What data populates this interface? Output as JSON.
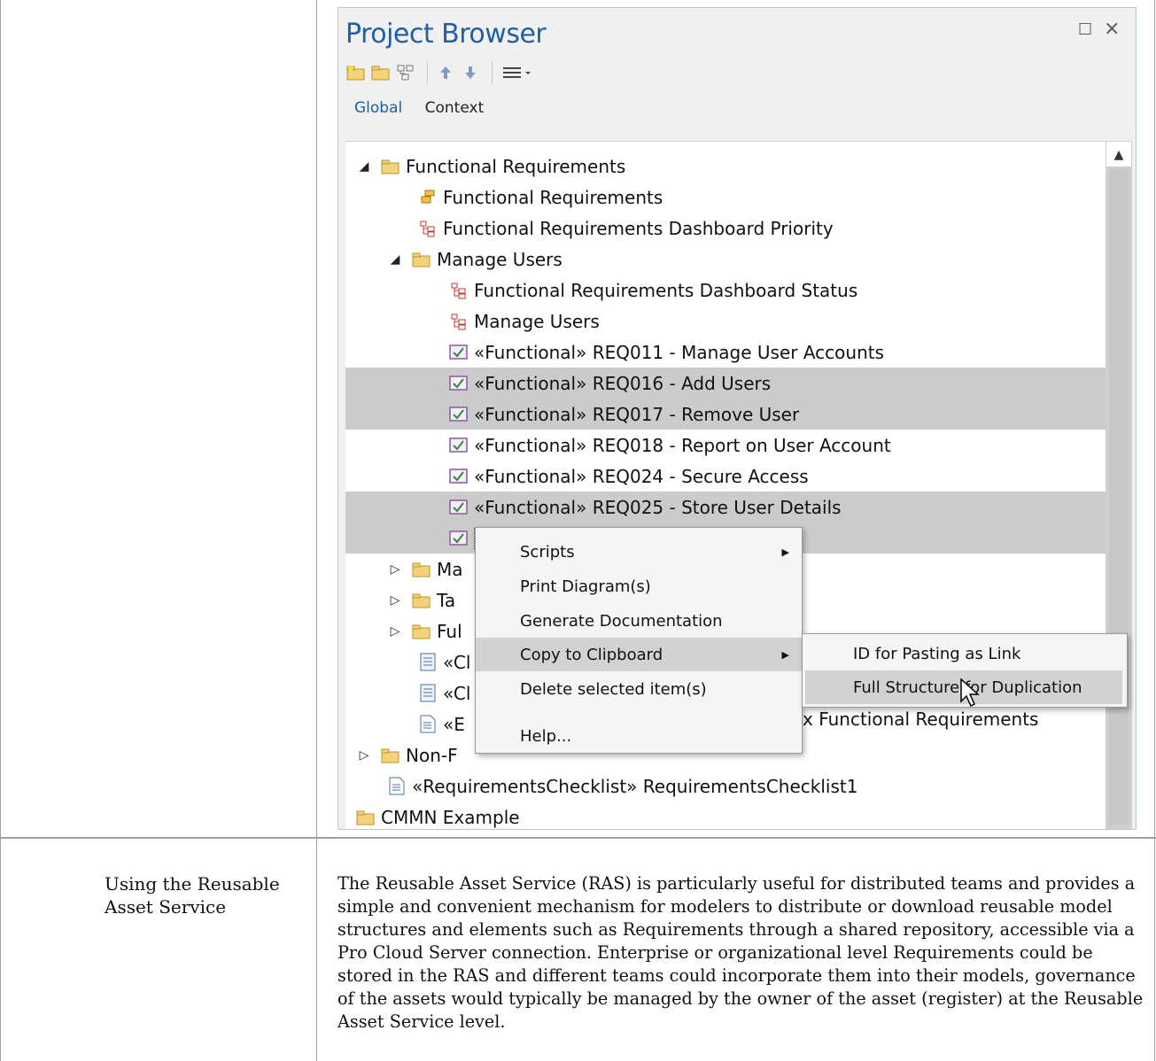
{
  "window": {
    "title": "Project Browser",
    "maximize_glyph": "☐",
    "close_glyph": "×"
  },
  "toolbar": {
    "icons": [
      "new-package-icon",
      "new-folder-icon",
      "new-diagram-icon",
      "move-up-icon",
      "move-down-icon",
      "menu-icon"
    ]
  },
  "tabs": [
    {
      "label": "Global",
      "active": true
    },
    {
      "label": "Context",
      "active": false
    }
  ],
  "tree": {
    "rows": [
      {
        "label": "Functional Requirements",
        "icon": "package-folder-icon",
        "expand": "▲",
        "selected": false
      },
      {
        "label": "Functional Requirements",
        "icon": "package-diagram-icon",
        "expand": "",
        "selected": false
      },
      {
        "label": "Functional Requirements Dashboard Priority",
        "icon": "dashboard-diagram-icon",
        "expand": "",
        "selected": false
      },
      {
        "label": "Manage Users",
        "icon": "package-folder-icon",
        "expand": "▲",
        "selected": false
      },
      {
        "label": "Functional Requirements Dashboard Status",
        "icon": "dashboard-diagram-icon",
        "expand": "",
        "selected": false
      },
      {
        "label": "Manage Users",
        "icon": "dashboard-diagram-icon",
        "expand": "",
        "selected": false
      },
      {
        "label": "«Functional» REQ011 - Manage User Accounts",
        "icon": "requirement-icon",
        "expand": "",
        "selected": false
      },
      {
        "label": "«Functional» REQ016 - Add Users",
        "icon": "requirement-icon",
        "expand": "",
        "selected": true
      },
      {
        "label": "«Functional» REQ017 - Remove User",
        "icon": "requirement-icon",
        "expand": "",
        "selected": true
      },
      {
        "label": "«Functional» REQ018 - Report on User Account",
        "icon": "requirement-icon",
        "expand": "",
        "selected": false
      },
      {
        "label": "«Functional» REQ024 - Secure Access",
        "icon": "requirement-icon",
        "expand": "",
        "selected": false
      },
      {
        "label": "«Functional» REQ025 - Store User Details",
        "icon": "requirement-icon",
        "expand": "",
        "selected": true
      },
      {
        "label": "",
        "icon": "requirement-icon",
        "expand": "",
        "selected": true
      },
      {
        "label": "Ma",
        "icon": "package-folder-icon",
        "expand": "▷",
        "selected": false
      },
      {
        "label": "Ta",
        "icon": "package-folder-icon",
        "expand": "▷",
        "selected": false
      },
      {
        "label": "Ful",
        "icon": "package-folder-icon",
        "expand": "▷",
        "selected": false
      },
      {
        "label": "«Cl",
        "icon": "checklist-icon",
        "expand": "",
        "selected": false
      },
      {
        "label": "«Cl",
        "icon": "checklist-icon",
        "expand": "",
        "selected": false
      },
      {
        "label": "«E",
        "icon": "document-icon",
        "expand": "",
        "selected": false
      },
      {
        "label": "Non-F",
        "icon": "package-folder-icon",
        "expand": "▷",
        "selected": false
      },
      {
        "label": "«RequirementsChecklist» RequirementsChecklist1",
        "icon": "document-icon",
        "expand": "",
        "selected": false
      },
      {
        "label": "CMMN Example",
        "icon": "package-folder-icon",
        "expand": "",
        "selected": false
      }
    ],
    "obscured_tail": "x Functional Requirements"
  },
  "context_menu": {
    "items": [
      {
        "label": "Scripts",
        "submenu": true,
        "highlight": false
      },
      {
        "label": "Print Diagram(s)",
        "submenu": false,
        "highlight": false
      },
      {
        "label": "Generate Documentation",
        "submenu": false,
        "highlight": false
      },
      {
        "label": "Copy to Clipboard",
        "submenu": true,
        "highlight": true
      },
      {
        "label": "Delete selected item(s)",
        "submenu": false,
        "highlight": false
      },
      {
        "label": "Help...",
        "submenu": false,
        "highlight": false
      }
    ]
  },
  "submenu": {
    "items": [
      {
        "label": "ID for Pasting as Link",
        "highlight": false
      },
      {
        "label": "Full Structure for Duplication",
        "highlight": true
      }
    ]
  },
  "doc": {
    "left_cell": "Using the Reusable Asset Service",
    "right_cell": "The Reusable Asset Service (RAS) is particularly useful for distributed teams and provides a simple and convenient mechanism for modelers to distribute or download reusable model structures and elements such as Requirements through a shared repository, accessible via a Pro Cloud Server connection. Enterprise or organizational level Requirements could be stored in the RAS and different teams could incorporate them into their models, governance of the assets would typically be managed by the owner of the asset (register) at the Reusable Asset Service level."
  },
  "colors": {
    "title_blue": "#1e5fa8",
    "selection_gray": "#cbcbcb",
    "folder_yellow": "#f3d27a",
    "requirement_purple": "#8a5a9a",
    "diagram_red": "#c0392b"
  }
}
